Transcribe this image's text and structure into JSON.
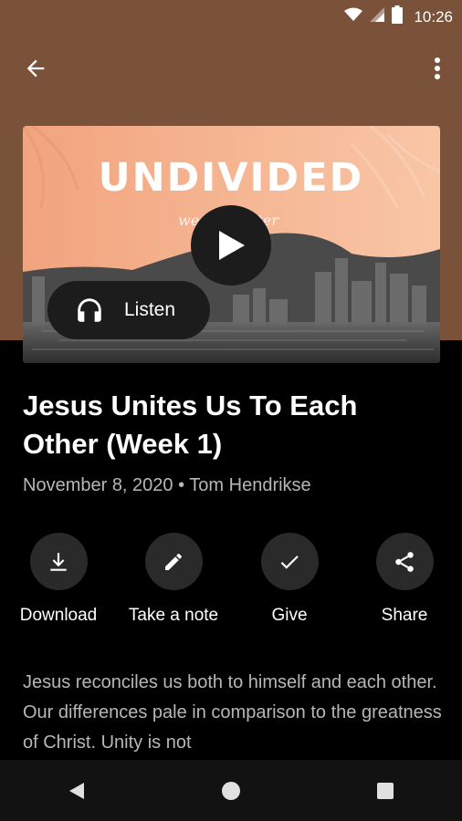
{
  "status_bar": {
    "time": "10:26"
  },
  "artwork": {
    "title": "UNDIVIDED",
    "subtitle": "we are better"
  },
  "listen_label": "Listen",
  "sermon": {
    "title": "Jesus Unites Us To Each Other (Week 1)",
    "meta": "November 8, 2020 • Tom Hendrikse"
  },
  "actions": [
    {
      "label": "Download",
      "icon": "download-icon"
    },
    {
      "label": "Take a note",
      "icon": "pencil-icon"
    },
    {
      "label": "Give",
      "icon": "check-icon"
    },
    {
      "label": "Share",
      "icon": "share-icon"
    }
  ],
  "description": "Jesus reconciles us both to himself and each other. Our differences pale in comparison to the greatness of Christ. Unity is not",
  "colors": {
    "header_bg": "#7a5139",
    "body_bg": "#000000",
    "button_bg": "#1c1c1c",
    "action_circle": "#2a2a2a"
  }
}
